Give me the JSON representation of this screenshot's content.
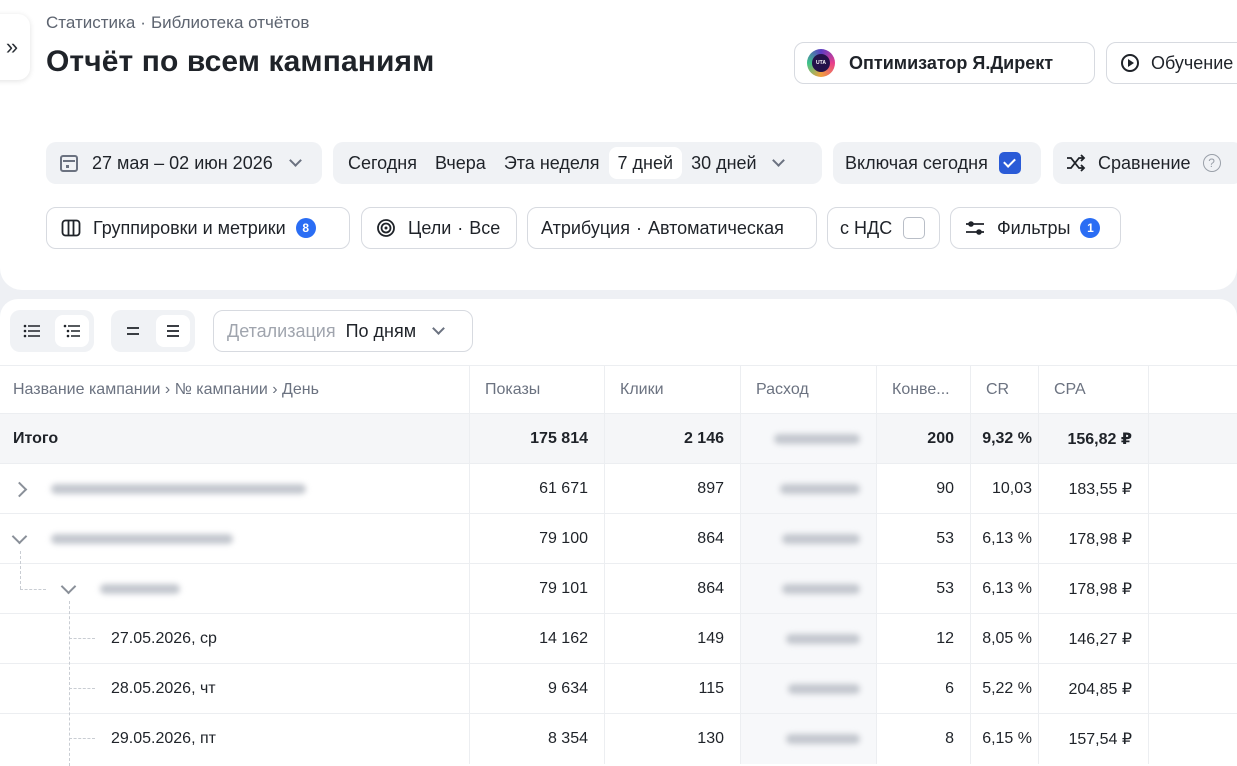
{
  "breadcrumb": {
    "root": "Статистика",
    "current": "Библиотека отчётов"
  },
  "page_title": "Отчёт по всем кампаниям",
  "header_buttons": {
    "optimizer": "Оптимизатор Я.Директ",
    "optimizer_logo_text": "UTA",
    "learning": "Обучение"
  },
  "filters": {
    "date_range": "27 мая – 02 июн 2026",
    "periods": [
      {
        "label": "Сегодня",
        "active": false
      },
      {
        "label": "Вчера",
        "active": false
      },
      {
        "label": "Эта неделя",
        "active": false
      },
      {
        "label": "7 дней",
        "active": true
      },
      {
        "label": "30 дней",
        "active": false
      }
    ],
    "include_today": "Включая сегодня",
    "include_today_checked": true,
    "comparison": "Сравнение",
    "help": "?",
    "groupings": "Группировки и метрики",
    "groupings_count": "8",
    "goals_label": "Цели",
    "goals_value": "Все",
    "attribution_label": "Атрибуция",
    "attribution_value": "Автоматическая",
    "vat": "с НДС",
    "vat_checked": false,
    "filters_label": "Фильтры",
    "filters_count": "1",
    "dot": "·"
  },
  "toolbar": {
    "detail_label": "Детализация",
    "detail_value": "По дням"
  },
  "table": {
    "columns": [
      "Название кампании › № кампании › День",
      "Показы",
      "Клики",
      "Расход",
      "Конве...",
      "CR",
      "CPA"
    ],
    "total": {
      "name": "Итого",
      "shows": "175 814",
      "clicks": "2 146",
      "conv": "200",
      "cr": "9,32 %",
      "cpa": "156,82 ₽"
    },
    "rows": [
      {
        "name": "",
        "shows": "61 671",
        "clicks": "897",
        "conv": "90",
        "cr": "10,03",
        "cpa": "183,55 ₽"
      },
      {
        "name": "",
        "shows": "79 100",
        "clicks": "864",
        "conv": "53",
        "cr": "6,13 %",
        "cpa": "178,98 ₽"
      },
      {
        "name": "",
        "shows": "79 101",
        "clicks": "864",
        "conv": "53",
        "cr": "6,13 %",
        "cpa": "178,98 ₽"
      },
      {
        "name": "27.05.2026, ср",
        "shows": "14 162",
        "clicks": "149",
        "conv": "12",
        "cr": "8,05 %",
        "cpa": "146,27 ₽"
      },
      {
        "name": "28.05.2026, чт",
        "shows": "9 634",
        "clicks": "115",
        "conv": "6",
        "cr": "5,22 %",
        "cpa": "204,85 ₽"
      },
      {
        "name": "29.05.2026, пт",
        "shows": "8 354",
        "clicks": "130",
        "conv": "8",
        "cr": "6,15 %",
        "cpa": "157,54 ₽"
      }
    ]
  }
}
